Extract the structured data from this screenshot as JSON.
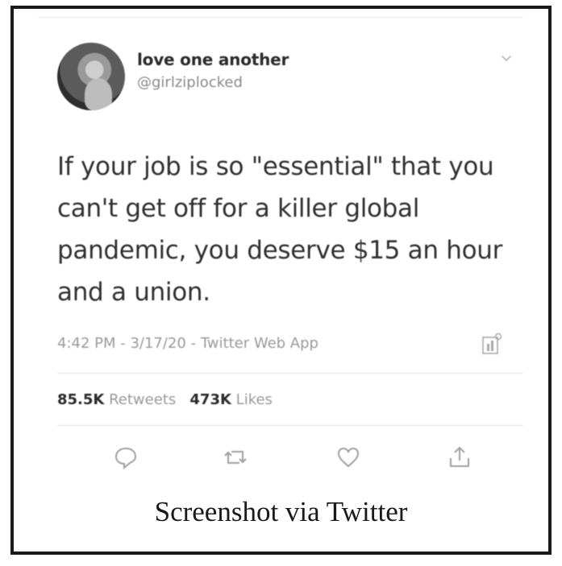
{
  "tweet": {
    "display_name": "love one another",
    "handle": "@girlziplocked",
    "text_lines": [
      "If your job is so \"essential\" that you",
      "can't get off for a killer global",
      "pandemic, you deserve $15 an hour",
      "and a union."
    ],
    "meta": "4:42 PM - 3/17/20 - Twitter Web App",
    "retweet_count": "85.5K",
    "retweet_label": "Retweets",
    "like_count": "473K",
    "like_label": "Likes",
    "icons": {
      "caret": "chevron-down-icon",
      "analytics": "analytics-icon",
      "reply": "reply-icon",
      "retweet": "retweet-icon",
      "like": "heart-icon",
      "share": "share-icon"
    }
  },
  "caption": "Screenshot via Twitter"
}
